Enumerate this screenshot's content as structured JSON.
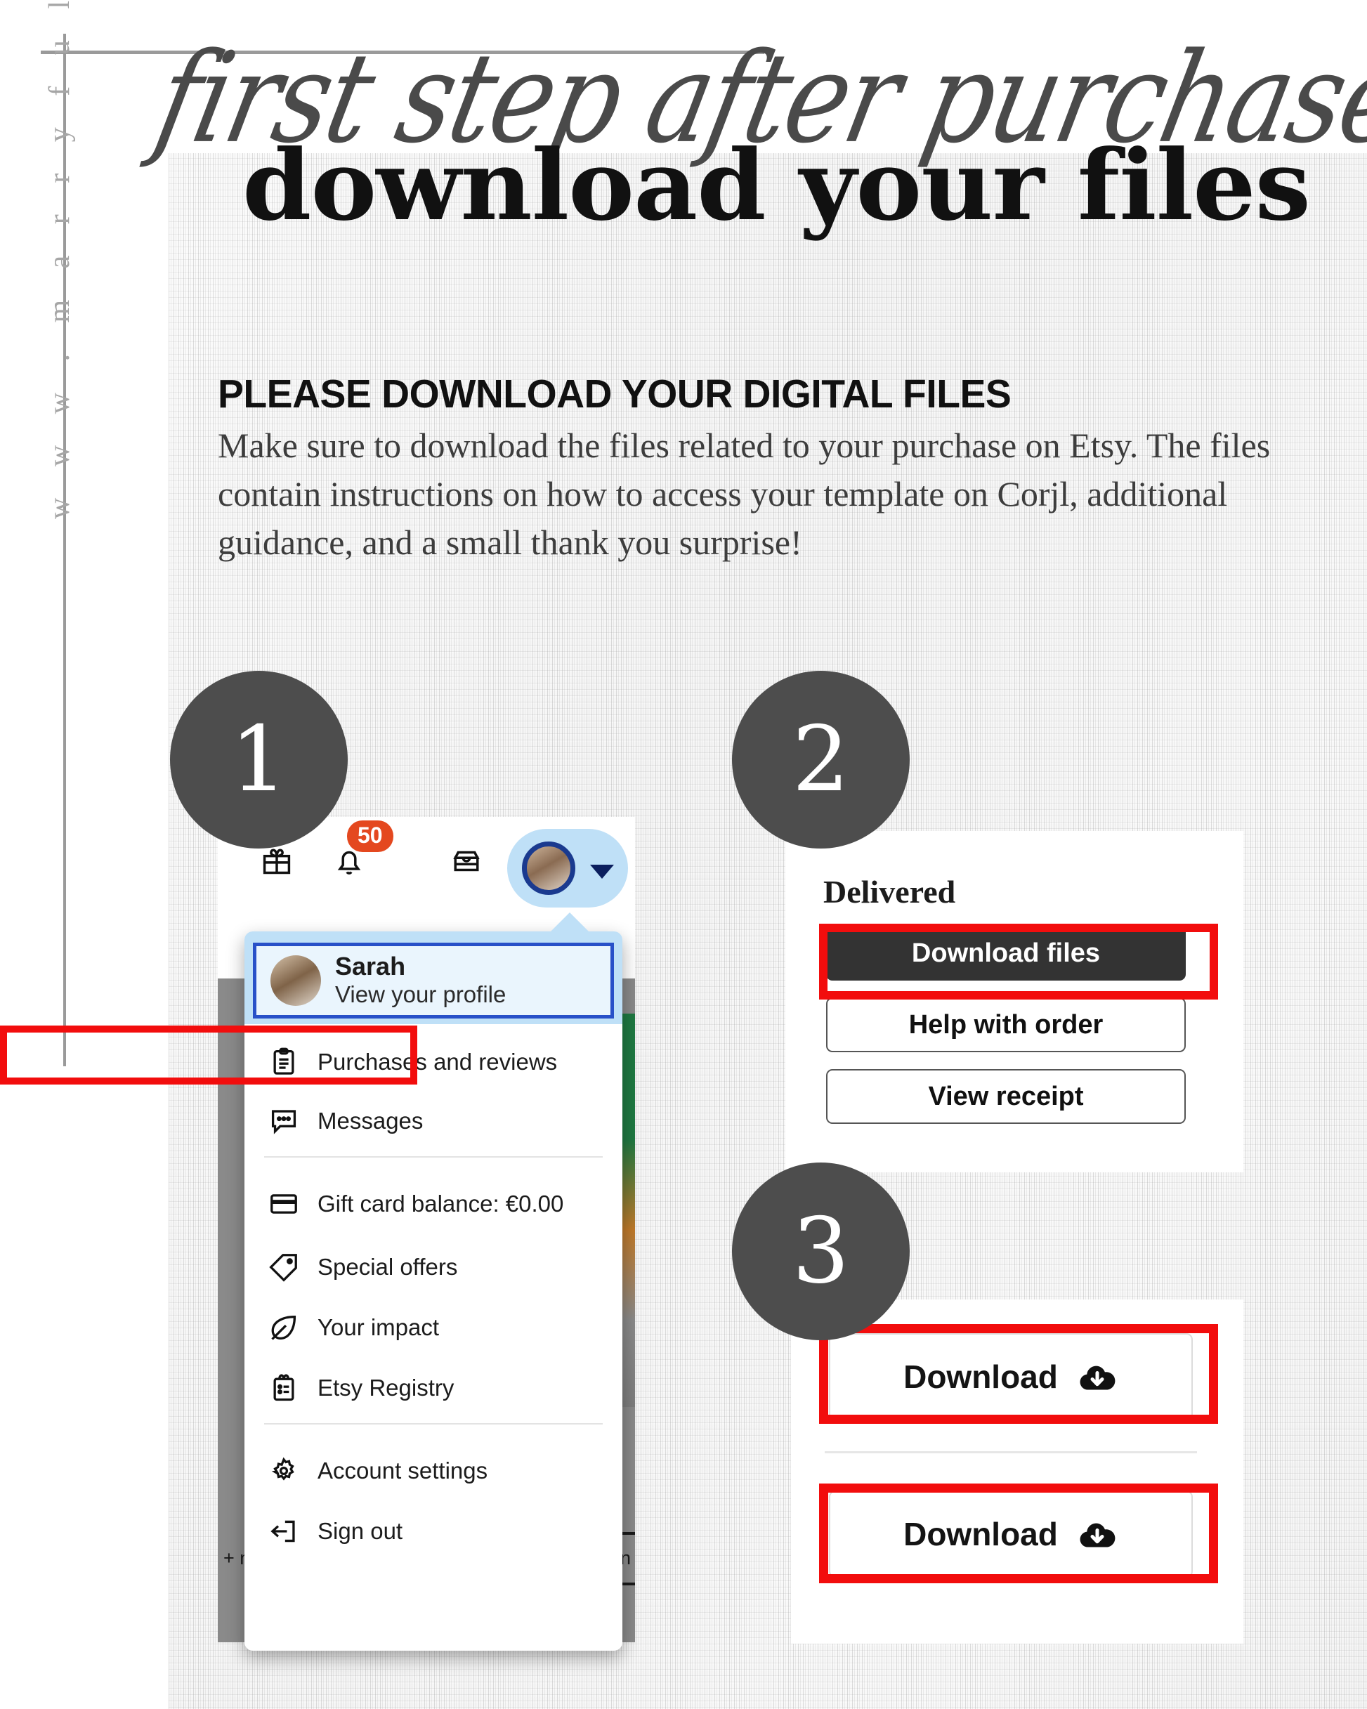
{
  "watermark": {
    "url": "w w w . m a r r y f u l . o r g"
  },
  "header": {
    "script_title": "first step after purchase:",
    "main_title": "download your files"
  },
  "intro": {
    "subhead": "PLEASE DOWNLOAD YOUR DIGITAL FILES",
    "paragraph": "Make sure to download the files related to your purchase on Etsy. The files contain instructions on how to access your template on Corjl, additional guidance, and a small thank you surprise!"
  },
  "steps": {
    "one": "1",
    "two": "2",
    "three": "3"
  },
  "step1": {
    "toolbar": {
      "gift_icon": "gift-icon",
      "bell_icon": "bell-icon",
      "notification_count": "50",
      "shop_icon": "shop-icon",
      "avatar_icon": "avatar-icon",
      "caret_icon": "chevron-down-icon"
    },
    "profile": {
      "name": "Sarah",
      "subtitle": "View your profile"
    },
    "menu": [
      {
        "icon": "clipboard-icon",
        "label": "Purchases and reviews"
      },
      {
        "icon": "message-bubble-icon",
        "label": "Messages"
      },
      {
        "icon": "credit-card-icon",
        "label": "Gift card balance: €0.00"
      },
      {
        "icon": "price-tag-icon",
        "label": "Special offers"
      },
      {
        "icon": "leaf-icon",
        "label": "Your impact"
      },
      {
        "icon": "registry-icon",
        "label": "Etsy Registry"
      },
      {
        "icon": "gear-icon",
        "label": "Account settings"
      },
      {
        "icon": "sign-out-icon",
        "label": "Sign out"
      }
    ],
    "background_fragments": {
      "left": "+ m",
      "right": "an"
    }
  },
  "step2": {
    "status": "Delivered",
    "download_files": "Download files",
    "help_with_order": "Help with order",
    "view_receipt": "View receipt"
  },
  "step3": {
    "download_a": "Download",
    "download_b": "Download",
    "icon": "cloud-download-icon"
  },
  "colors": {
    "highlight_red": "#f20d0d",
    "badge_grey": "#4d4d4d",
    "etsy_orange": "#e4481f",
    "focus_blue": "#2850c8",
    "pill_blue": "#bfe0f7",
    "dark_button": "#333333"
  }
}
